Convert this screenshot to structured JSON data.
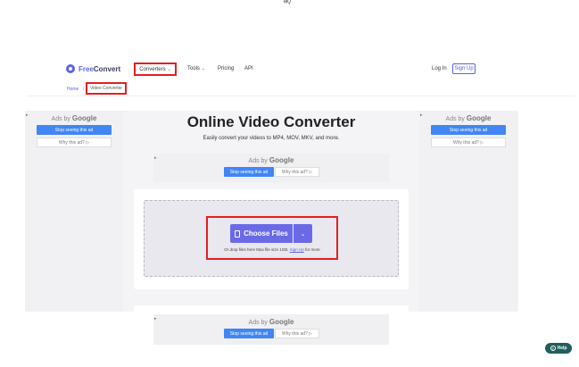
{
  "top_mark": "ᴿᴷ/",
  "header": {
    "logo_free": "Free",
    "logo_convert": "Convert",
    "nav": {
      "converters": "Converters",
      "tools": "Tools",
      "pricing": "Pricing",
      "api": "API"
    },
    "login": "Log In",
    "signup": "Sign Up"
  },
  "breadcrumb": {
    "home": "Home",
    "separator": "/",
    "current": "Video Converter"
  },
  "page": {
    "title": "Online Video Converter",
    "subtitle": "Easily convert your videos to MP4, MOV, MKV, and more."
  },
  "ads": {
    "ads_by": "Ads by",
    "google": "Google",
    "stop": "Stop seeing this ad",
    "why": "Why this ad? ▷",
    "corner": "▸"
  },
  "upload": {
    "choose_files": "Choose Files",
    "hint_prefix": "Or drop files here Max file size 1GB.",
    "hint_link": "Sign Up",
    "hint_suffix": "for more"
  },
  "help": {
    "label": "Help",
    "q": "?"
  },
  "colors": {
    "accent": "#5b63e8",
    "button": "#6a6ae8",
    "highlight": "#e02020",
    "google_blue": "#4285f4",
    "help_bg": "#1f5f5b"
  }
}
